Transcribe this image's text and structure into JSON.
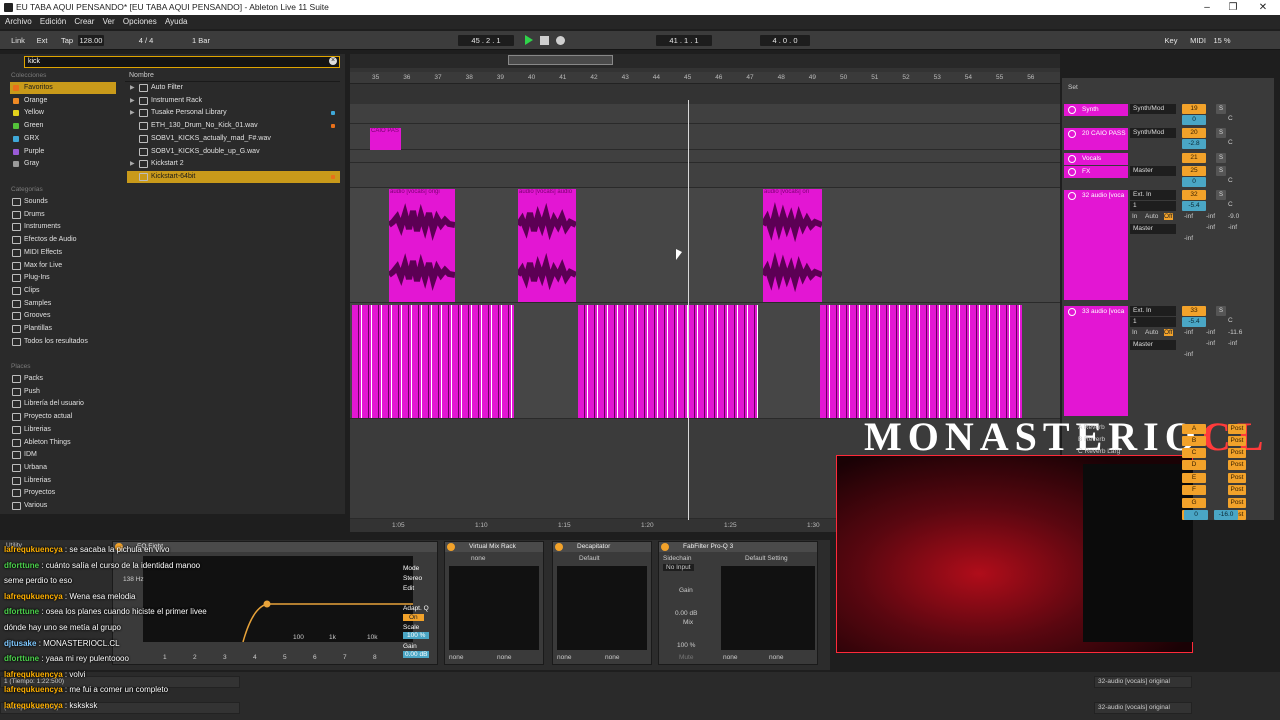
{
  "window": {
    "title": "EU TABA AQUI PENSANDO*  [EU TABA AQUI PENSANDO] - Ableton Live 11 Suite",
    "controls": [
      "–",
      "❐",
      "✕"
    ]
  },
  "menu": [
    "Archivo",
    "Edición",
    "Crear",
    "Ver",
    "Opciones",
    "Ayuda"
  ],
  "transport": {
    "link": "Link",
    "ext": "Ext",
    "tap": "Tap",
    "tempo": "128.00",
    "signature": "4 / 4",
    "quantize": "1 Bar",
    "arr_position": "45 .  2 .  1",
    "loop_start": "41 .  1 .  1",
    "loop_length": "4 .  0 .  0",
    "key": "Key",
    "midi": "MIDI",
    "cpu": "15 %"
  },
  "browser": {
    "search_value": "kick",
    "collections_header": "Colecciones",
    "collections": [
      {
        "label": "Favoritos",
        "color": "#e8701a",
        "selected": true
      },
      {
        "label": "Orange",
        "color": "#f08a24"
      },
      {
        "label": "Yellow",
        "color": "#e2d21c"
      },
      {
        "label": "Green",
        "color": "#54c23a"
      },
      {
        "label": "GRX",
        "color": "#3fa8d8"
      },
      {
        "label": "Purple",
        "color": "#9b5bd8"
      },
      {
        "label": "Gray",
        "color": "#9a9a9a"
      }
    ],
    "categories_header": "Categorías",
    "categories": [
      "Sounds",
      "Drums",
      "Instruments",
      "Efectos de Audio",
      "MIDI Effects",
      "Max for Live",
      "Plug-Ins",
      "Clips",
      "Samples",
      "Grooves",
      "Plantillas",
      "Todos los resultados"
    ],
    "places_header": "Places",
    "places": [
      "Packs",
      "Push",
      "Librería del usuario",
      "Proyecto actual",
      "Librerias",
      "Ableton Things",
      "IDM",
      "Urbana",
      "Librerias",
      "Proyectos",
      "Various"
    ],
    "name_header": "Nombre",
    "files": [
      {
        "label": "Auto Filter",
        "folder": true
      },
      {
        "label": "Instrument Rack",
        "folder": true
      },
      {
        "label": "Tusake Personal Library",
        "folder": true,
        "tag": "#3fa8d8"
      },
      {
        "label": "ETH_130_Drum_No_Kick_01.wav",
        "tag": "#e8701a"
      },
      {
        "label": "SOBV1_KICKS_actually_mad_F#.wav"
      },
      {
        "label": "SOBV1_KICKS_double_up_G.wav"
      },
      {
        "label": "Kickstart 2",
        "folder": true
      },
      {
        "label": "Kickstart-64bit",
        "selected": true,
        "tag": "#e8701a"
      }
    ]
  },
  "arrangement": {
    "bars": [
      "35",
      "36",
      "37",
      "38",
      "39",
      "40",
      "41",
      "42",
      "43",
      "44",
      "45",
      "46",
      "47",
      "48",
      "49",
      "50",
      "51",
      "52",
      "53",
      "54",
      "55",
      "56"
    ],
    "time_marks": [
      "1:05",
      "1:10",
      "1:15",
      "1:20",
      "1:25",
      "1:30"
    ],
    "clip_labels": {
      "caio": "CAIO PAS",
      "vocals_a": "audio [vocals] origi",
      "vocals_b": "audio [vocals] audio",
      "vocals_c": "audio [vocals] ori"
    },
    "set_label": "Set"
  },
  "mixer": {
    "tracks": [
      {
        "name": "Synth",
        "io": "Synth/Mod",
        "num": "19",
        "vol": "0"
      },
      {
        "name": "20 CAIO PASS",
        "io": "Synth/Mod",
        "num": "20",
        "vol": "-2.8"
      },
      {
        "name": "Vocals",
        "num": "21"
      },
      {
        "name": "FX",
        "io": "Master",
        "num": "25",
        "vol": "0"
      },
      {
        "name": "32 audio [voca",
        "io": "Ext. In",
        "num": "32",
        "vol": "-5.4",
        "peak": "-9.0",
        "input": "1",
        "out": "Master"
      },
      {
        "name": "33 audio [voca",
        "io": "Ext. In",
        "num": "33",
        "vol": "-5.4",
        "peak": "-11.6",
        "input": "1",
        "out": "Master"
      }
    ],
    "monitor_in": "In",
    "monitor_auto": "Auto",
    "monitor_off": "Off",
    "inf": "-inf",
    "pan": "C",
    "solo": "S",
    "returns": [
      {
        "name": "A Reverb",
        "letter": "A"
      },
      {
        "name": "B Reverb",
        "letter": "B"
      },
      {
        "name": "C Reverb Larg",
        "letter": "C"
      }
    ],
    "return_letters": [
      "D",
      "E",
      "F",
      "G",
      "H"
    ],
    "post": "Post",
    "master_vol": "0",
    "master_peak": "-16.0"
  },
  "devices": {
    "utility": "Utility",
    "eq": "EQ Eight",
    "eq_freq": "138 Hz",
    "eq_ticks": [
      "100",
      "1k",
      "10k"
    ],
    "eq_bands": [
      "1",
      "2",
      "3",
      "4",
      "5",
      "6",
      "7",
      "8"
    ],
    "eq_mode": "Mode",
    "eq_mode_value": "Stereo",
    "eq_edit": "Edit",
    "eq_adapt": "Adapt. Q",
    "eq_on": "On",
    "eq_scale": "Scale",
    "eq_scale_value": "100 %",
    "eq_gain": "Gain",
    "eq_gain_value": "0.00 dB",
    "vmr": "Virtual Mix Rack",
    "vmr_preset": "none",
    "decap": "Decapitator",
    "decap_preset": "Default",
    "proq": "FabFilter Pro-Q 3",
    "sidechain": "Sidechain",
    "sidechain_value": "No Input",
    "gain_label": "Gain",
    "gain_value": "0.00 dB",
    "mix_label": "Mix",
    "mix_value": "100 %",
    "mute": "Mute",
    "proq_preset": "Default Setting",
    "none": "none"
  },
  "overlay": {
    "brand_main": "MONASTERIO",
    "brand_accent": "CL"
  },
  "chat": [
    {
      "user": "lafrequkuencya",
      "text": "se sacaba la pichula en vivo",
      "color": "#ffb000"
    },
    {
      "user": "dforttune",
      "text": "cuánto salía el curso de la identidad manoo",
      "color": "#4bd04b"
    },
    {
      "user": "",
      "text": "seme perdio to eso",
      "color": "#ffffff"
    },
    {
      "user": "lafrequkuencya",
      "text": "Wena esa melodia",
      "color": "#ffb000"
    },
    {
      "user": "dforttune",
      "text": "osea los planes cuando hiciste el primer livee",
      "color": "#4bd04b"
    },
    {
      "user": "",
      "text": "dónde hay uno se metía al grupo",
      "color": "#ffffff"
    },
    {
      "user": "djtusake",
      "text": "MONASTERIOCL.CL",
      "color": "#7ec8ff"
    },
    {
      "user": "dforttune",
      "text": "yaaa mi rey pulentoooo",
      "color": "#4bd04b"
    },
    {
      "user": "lafrequkuencya",
      "text": "volvi",
      "color": "#ffb000"
    },
    {
      "user": "lafrequkuencya",
      "text": "me fui a comer un completo",
      "color": "#ffb000"
    },
    {
      "user": "lafrequkuencya",
      "text": "ksksksk",
      "color": "#ffb000"
    }
  ],
  "status": {
    "time1": "1 (Tiempo: 1:22:500)",
    "time2": "(Tiempo: 1:22:500)",
    "track1": "32-audio [vocals] original",
    "track2": "32-audio [vocals] original"
  }
}
